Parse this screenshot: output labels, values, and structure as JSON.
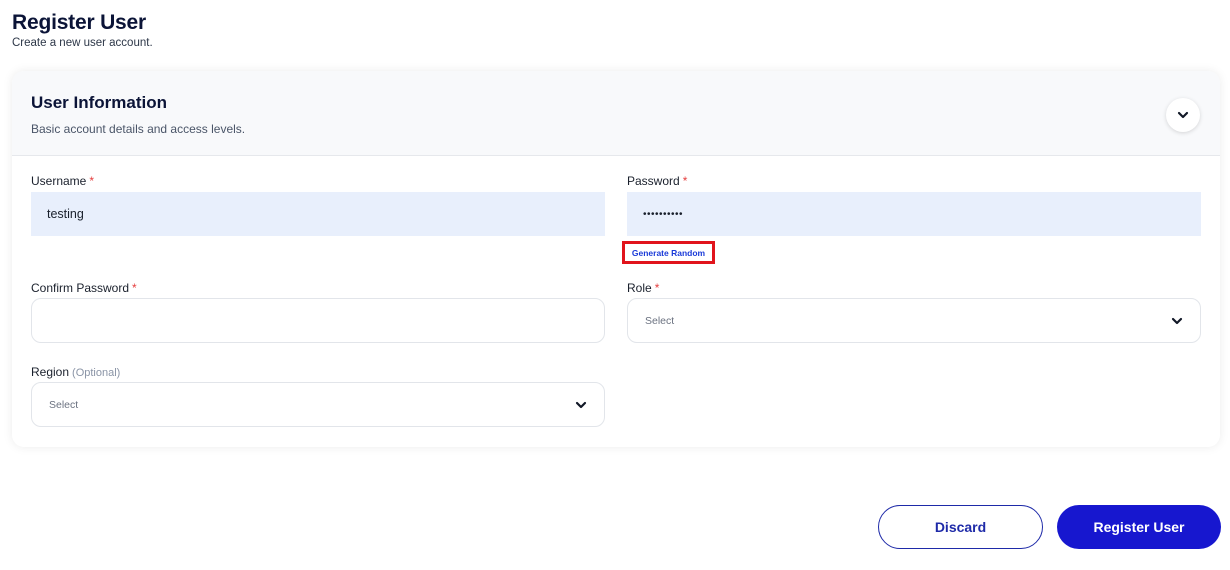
{
  "page": {
    "title": "Register User",
    "subtitle": "Create a new user account."
  },
  "section": {
    "title": "User Information",
    "subtitle": "Basic account details and access levels.",
    "collapse_icon": "chevron-down-icon"
  },
  "fields": {
    "username": {
      "label": "Username",
      "required": "*",
      "value": "testing"
    },
    "password": {
      "label": "Password",
      "required": "*",
      "value": "••••••••••"
    },
    "generate_random": "Generate Random",
    "confirm_password": {
      "label": "Confirm Password",
      "required": "*",
      "value": ""
    },
    "role": {
      "label": "Role",
      "required": "*",
      "value": "Select"
    },
    "region": {
      "label": "Region",
      "optional": "(Optional)",
      "value": "Select"
    }
  },
  "actions": {
    "discard": "Discard",
    "register": "Register User"
  },
  "colors": {
    "primary": "#1717cf",
    "required": "#e53e3e",
    "highlight_border": "#e1141c",
    "input_fill": "#e8effc"
  }
}
